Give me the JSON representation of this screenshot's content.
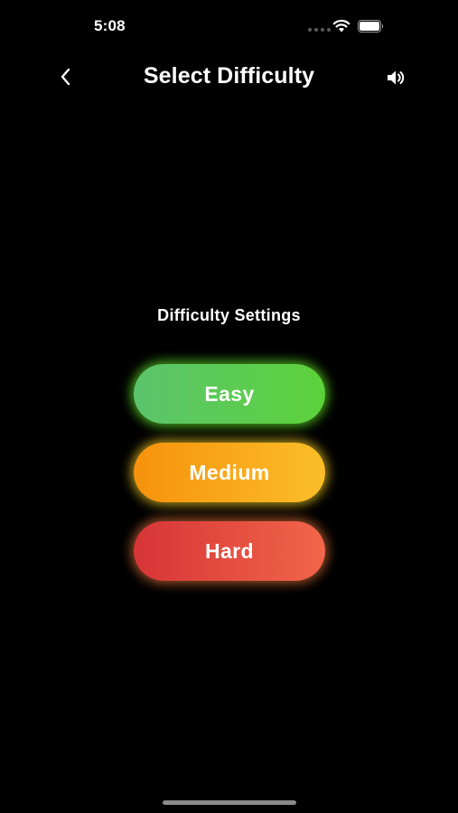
{
  "status_bar": {
    "time": "5:08",
    "icons": [
      "signal-dots-icon",
      "wifi-icon",
      "battery-icon"
    ]
  },
  "nav": {
    "back_icon": "chevron-left-icon",
    "title": "Select Difficulty",
    "sound_icon": "speaker-volume-icon"
  },
  "main": {
    "heading": "Difficulty Settings",
    "options": [
      {
        "label": "Easy",
        "colors": [
          "#5cc46e",
          "#5cd23a"
        ]
      },
      {
        "label": "Medium",
        "colors": [
          "#f7920d",
          "#fbbe29"
        ]
      },
      {
        "label": "Hard",
        "colors": [
          "#d63537",
          "#f2664a"
        ]
      }
    ]
  },
  "colors": {
    "background": "#000000",
    "text": "#ffffff"
  }
}
